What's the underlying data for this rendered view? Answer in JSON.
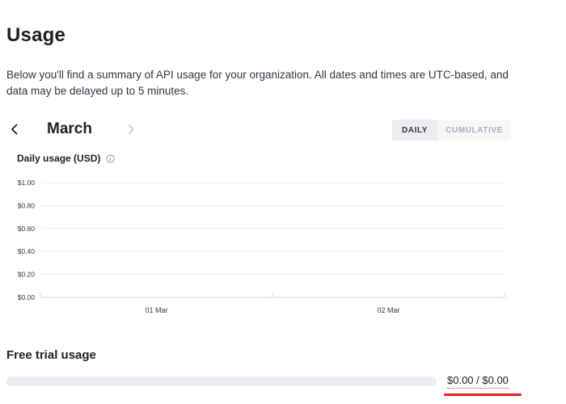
{
  "header": {
    "title": "Usage",
    "description": "Below you'll find a summary of API usage for your organization. All dates and times are UTC-based, and data may be delayed up to 5 minutes."
  },
  "month_nav": {
    "month": "March",
    "prev_icon": "chevron-left-icon",
    "next_icon": "chevron-right-icon"
  },
  "view_toggle": {
    "daily_label": "DAILY",
    "cumulative_label": "CUMULATIVE",
    "selected": "DAILY"
  },
  "chart": {
    "title": "Daily usage (USD)",
    "info_icon": "info-icon"
  },
  "chart_data": {
    "type": "bar",
    "title": "Daily usage (USD)",
    "categories": [
      "01 Mar",
      "02 Mar"
    ],
    "values": [
      0,
      0
    ],
    "ylim": [
      0,
      1
    ],
    "yticks": [
      "$0.00",
      "$0.20",
      "$0.40",
      "$0.60",
      "$0.80",
      "$1.00"
    ],
    "ytick_values": [
      0,
      0.2,
      0.4,
      0.6,
      0.8,
      1.0
    ],
    "xlabel": "",
    "ylabel": "",
    "grid": true
  },
  "free_trial": {
    "title": "Free trial usage",
    "amount_text": "$0.00 / $0.00",
    "used_fraction": 0
  },
  "colors": {
    "accent": "#10a37f",
    "annotation_underline": "#e8211a",
    "grid": "#ececf1"
  }
}
